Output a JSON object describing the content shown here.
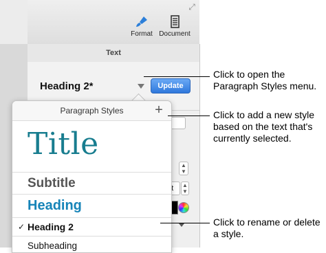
{
  "toolbar": {
    "format_label": "Format",
    "document_label": "Document"
  },
  "inspector": {
    "section_title": "Text",
    "current_style": "Heading 2*",
    "update_label": "Update",
    "peek_field_value": "pt",
    "stepper_glyph": "⌃\n⌄"
  },
  "popover": {
    "title": "Paragraph Styles",
    "add_glyph": "+",
    "items": [
      {
        "label": "Title"
      },
      {
        "label": "Subtitle"
      },
      {
        "label": "Heading"
      },
      {
        "label": "Heading 2",
        "checked": true
      },
      {
        "label": "Subheading"
      }
    ],
    "check_glyph": "✓"
  },
  "callouts": [
    {
      "text": "Click to open the Paragraph Styles menu."
    },
    {
      "text": "Click to add a new style based on the text that's currently selected."
    },
    {
      "text": "Click to rename or delete a style."
    }
  ],
  "colors": {
    "title_teal": "#187d8f",
    "heading_blue": "#1684b8",
    "update_blue": "#2f78dc"
  }
}
